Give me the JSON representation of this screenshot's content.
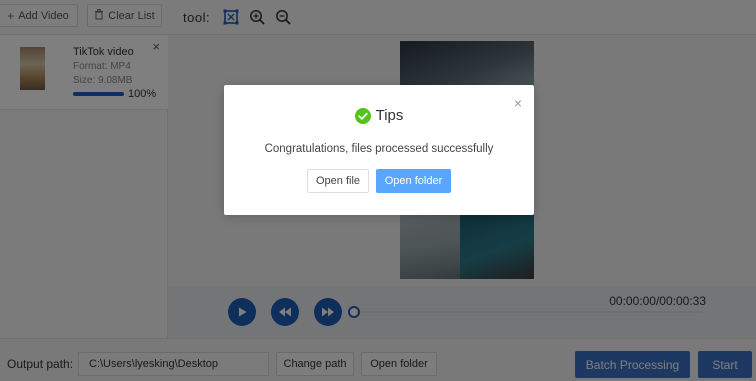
{
  "toolbar": {
    "add_video_label": "Add Video",
    "clear_list_label": "Clear List",
    "tool_label": "tool:",
    "icons": [
      "crop-icon",
      "zoom-in-icon",
      "zoom-out-icon"
    ]
  },
  "file_list": [
    {
      "name": "TikTok video",
      "format": "Format:  MP4",
      "size": "Size:  9.08MB",
      "progress_text": "100%",
      "progress": 1.0
    }
  ],
  "player": {
    "time": "00:00:00/00:00:33",
    "seek_fraction": 0.0
  },
  "bottom": {
    "output_label": "Output path:",
    "output_path": "C:\\Users\\lyesking\\Desktop",
    "change_path_label": "Change path",
    "open_folder_label": "Open folder",
    "batch_label": "Batch Processing",
    "start_label": "Start"
  },
  "dialog": {
    "title": "Tips",
    "message": "Congratulations, files processed successfully",
    "open_file_label": "Open file",
    "open_folder_label": "Open folder",
    "close_glyph": "×"
  },
  "colors": {
    "primary": "#3a73c7",
    "dialog_primary": "#5aa6ff",
    "success": "#52c41a"
  }
}
